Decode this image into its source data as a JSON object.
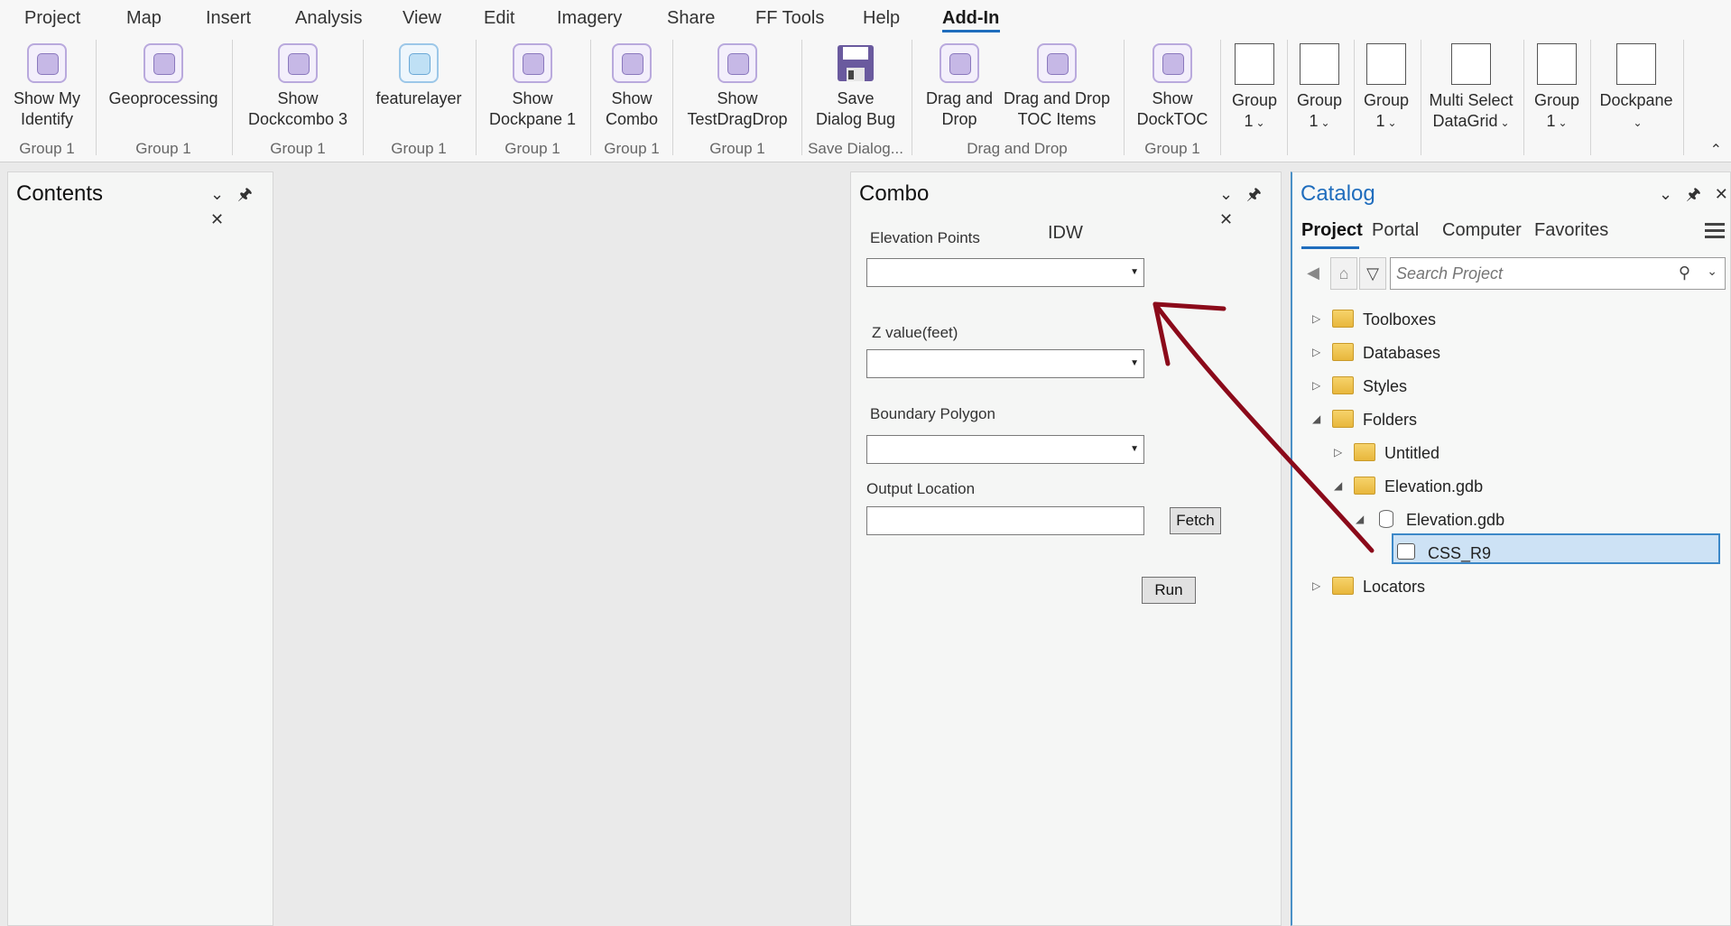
{
  "menu": {
    "items": [
      "Project",
      "Map",
      "Insert",
      "Analysis",
      "View",
      "Edit",
      "Imagery",
      "Share",
      "FF Tools",
      "Help",
      "Add-In"
    ],
    "active": "Add-In"
  },
  "ribbon": {
    "buttons": [
      {
        "line1": "Show My",
        "line2": "Identify"
      },
      {
        "line1": "Geoprocessing",
        "line2": ""
      },
      {
        "line1": "Show",
        "line2": "Dockcombo 3"
      },
      {
        "line1": "featurelayer",
        "line2": ""
      },
      {
        "line1": "Show",
        "line2": "Dockpane 1"
      },
      {
        "line1": "Show",
        "line2": "Combo"
      },
      {
        "line1": "Show",
        "line2": "TestDragDrop"
      },
      {
        "line1": "Save",
        "line2": "Dialog Bug"
      },
      {
        "line1": "Drag and",
        "line2": "Drop"
      },
      {
        "line1": "Drag and Drop",
        "line2": "TOC Items"
      },
      {
        "line1": "Show",
        "line2": "DockTOC"
      },
      {
        "line1": "Group",
        "line2": "1"
      },
      {
        "line1": "Group",
        "line2": "1"
      },
      {
        "line1": "Group",
        "line2": "1"
      },
      {
        "line1": "Multi Select",
        "line2": "DataGrid"
      },
      {
        "line1": "Group",
        "line2": "1"
      },
      {
        "line1": "Dockpane",
        "line2": ""
      }
    ],
    "groups": [
      "Group 1",
      "Group 1",
      "Group 1",
      "Group 1",
      "Group 1",
      "Group 1",
      "Group 1",
      "Save Dialog...",
      "Drag and Drop",
      "Group 1"
    ],
    "accent": "#1f6dbd"
  },
  "contents": {
    "title": "Contents"
  },
  "combo": {
    "title": "Combo",
    "idw_label": "IDW",
    "elevation_points_label": "Elevation Points",
    "z_value_label": "Z value(feet)",
    "boundary_polygon_label": "Boundary Polygon",
    "output_location_label": "Output Location",
    "fetch_label": "Fetch",
    "run_label": "Run",
    "elevation_points_value": "",
    "z_value_value": "",
    "boundary_polygon_value": "",
    "output_location_value": ""
  },
  "catalog": {
    "title": "Catalog",
    "tabs": [
      "Project",
      "Portal",
      "Computer",
      "Favorites"
    ],
    "active_tab": "Project",
    "search_placeholder": "Search Project",
    "tree": [
      {
        "label": "Toolboxes",
        "icon": "toolbox-folder-icon",
        "expanded": false
      },
      {
        "label": "Databases",
        "icon": "database-folder-icon",
        "expanded": false
      },
      {
        "label": "Styles",
        "icon": "styles-folder-icon",
        "expanded": false
      },
      {
        "label": "Folders",
        "icon": "folder-icon",
        "expanded": true
      },
      {
        "label": "Untitled",
        "icon": "home-folder-icon",
        "expanded": false
      },
      {
        "label": "Elevation.gdb",
        "icon": "folder-icon",
        "expanded": true
      },
      {
        "label": "Elevation.gdb",
        "icon": "geodatabase-icon",
        "expanded": true
      },
      {
        "label": "CSS_R9",
        "icon": "point-feature-class-icon",
        "selected": true
      },
      {
        "label": "Locators",
        "icon": "locator-folder-icon",
        "expanded": false
      }
    ],
    "accent": "#1f6dbd"
  },
  "annotation": {
    "arrow_color": "#8b0a1a",
    "icon": "drag-arrow-annotation"
  }
}
